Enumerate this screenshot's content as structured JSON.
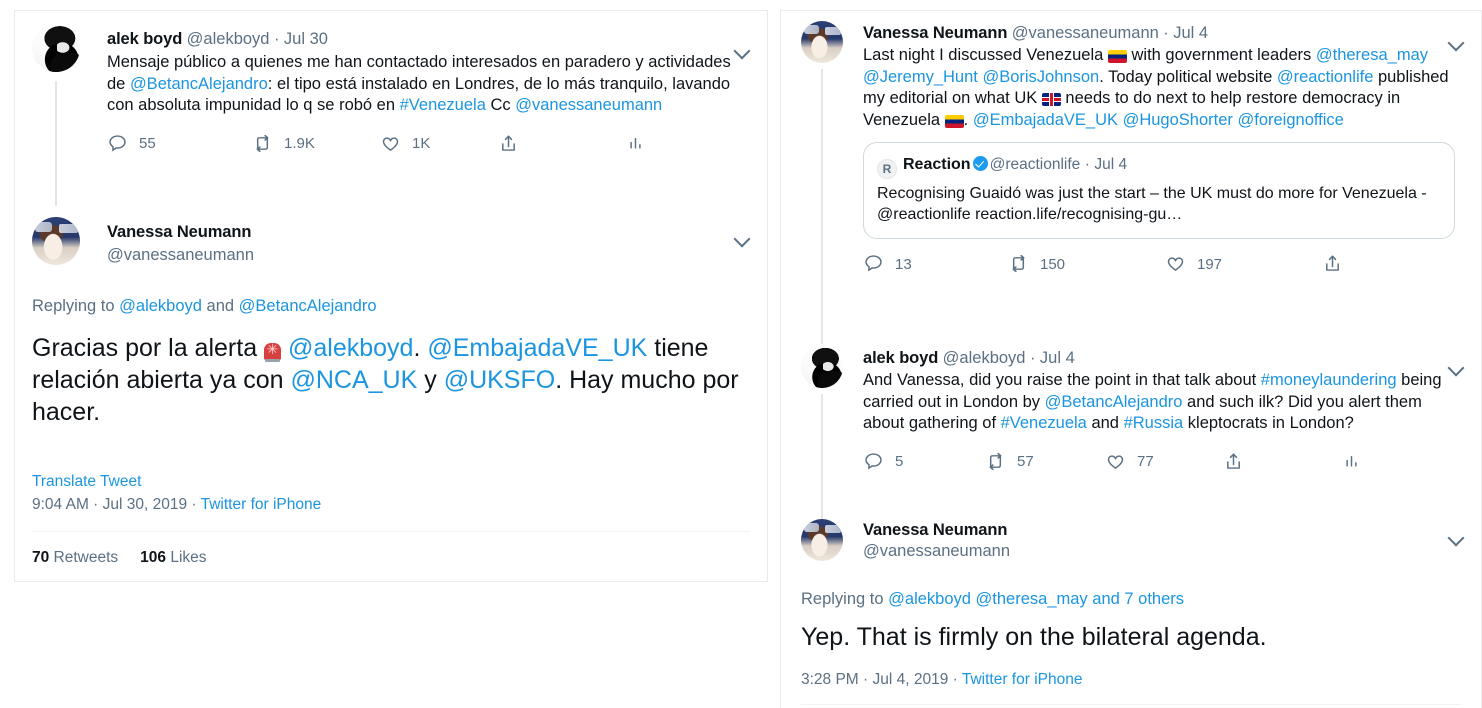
{
  "left_panel": {
    "tweet1": {
      "name": "alek boyd",
      "handle": "@alekboyd",
      "separator": "·",
      "date": "Jul 30",
      "text_part1": "Mensaje público a quienes me han contactado interesados en paradero y actividades de ",
      "mention1": "@BetancAlejandro",
      "text_part2": ": el tipo está instalado en Londres, de lo más tranquilo, lavando con absoluta impunidad lo q se robó en ",
      "hashtag1": "#Venezuela",
      "text_part3": " Cc ",
      "mention2": "@vanessaneumann",
      "replies": "55",
      "retweets": "1.9K",
      "likes": "1K"
    },
    "tweet2": {
      "name": "Vanessa Neumann",
      "handle": "@vanessaneumann",
      "replying_label": "Replying to ",
      "replying_mention1": "@alekboyd",
      "replying_and": " and ",
      "replying_mention2": "@BetancAlejandro",
      "text_part1": "Gracias por la alerta ",
      "emoji1": "siren",
      "mention1": "@alekboyd",
      "text_part2": ". ",
      "mention2": "@EmbajadaVE_UK",
      "text_part3": " tiene relación abierta ya con ",
      "mention3": "@NCA_UK",
      "text_part4": " y ",
      "mention4": "@UKSFO",
      "text_part5": ". Hay mucho por hacer.",
      "translate_link": "Translate Tweet",
      "time": "9:04 AM",
      "meta_sep1": " · ",
      "date": "Jul 30, 2019",
      "meta_sep2": " · ",
      "source": "Twitter for iPhone",
      "retweet_count": "70",
      "retweet_label": " Retweets",
      "like_count": "106",
      "like_label": " Likes"
    }
  },
  "right_panel": {
    "tweet1": {
      "name": "Vanessa Neumann",
      "handle": "@vanessaneumann",
      "separator": "·",
      "date": "Jul 4",
      "text_part1": "Last night I discussed Venezuela ",
      "emoji_ve1": "flag-venezuela",
      "text_part2": " with government leaders ",
      "mention1": "@theresa_may",
      "space1": " ",
      "mention2": "@Jeremy_Hunt",
      "space2": " ",
      "mention3": "@BorisJohnson",
      "text_part3": ". Today political website ",
      "mention4": "@reactionlife",
      "text_part4": " published my editorial on what UK ",
      "emoji_gb": "flag-uk",
      "text_part5": " needs to do next to help restore democracy in Venezuela ",
      "emoji_ve2": "flag-venezuela",
      "text_part6": ". ",
      "mention5": "@EmbajadaVE_UK",
      "text_part7": " ",
      "mention6": "@HugoShorter",
      "text_part8": " ",
      "mention7": "@foreignoffice",
      "quote": {
        "avatar_letter": "R",
        "name": "Reaction",
        "verified": true,
        "handle": "@reactionlife",
        "separator": "·",
        "date": "Jul 4",
        "text": "Recognising Guaidó was just the start – the UK must do more for Venezuela - @reactionlife reaction.life/recognising-gu…"
      },
      "replies": "13",
      "retweets": "150",
      "likes": "197"
    },
    "tweet2": {
      "name": "alek boyd",
      "handle": "@alekboyd",
      "separator": "·",
      "date": "Jul 4",
      "text_part1": "And Vanessa, did you raise the point in that talk about ",
      "hashtag1": "#moneylaundering",
      "text_part2": " being carried out in London by ",
      "mention1": "@BetancAlejandro",
      "text_part3": " and such ilk? Did you alert them about gathering of ",
      "hashtag2": "#Venezuela",
      "text_part4": " and ",
      "hashtag3": "#Russia",
      "text_part5": " kleptocrats in London?",
      "replies": "5",
      "retweets": "57",
      "likes": "77"
    },
    "tweet3": {
      "name": "Vanessa Neumann",
      "handle": "@vanessaneumann",
      "replying_label": "Replying to ",
      "replying_mention1": "@alekboyd",
      "replying_space": " ",
      "replying_mention2": "@theresa_may",
      "replying_others": " and 7 others",
      "text": "Yep. That is firmly on the bilateral agenda.",
      "time": "3:28 PM",
      "meta_sep1": " · ",
      "date": "Jul 4, 2019",
      "meta_sep2": " · ",
      "source": "Twitter for iPhone"
    }
  },
  "colors": {
    "link": "#1b95e0",
    "text": "#0f1419",
    "muted": "#5b7083",
    "verified": "#1d9bf0",
    "border": "#cfd9de"
  },
  "icons": {
    "reply": "reply-icon",
    "retweet": "retweet-icon",
    "like": "like-icon",
    "share": "share-icon",
    "analytics": "analytics-icon",
    "caret": "chevron-down-icon"
  }
}
